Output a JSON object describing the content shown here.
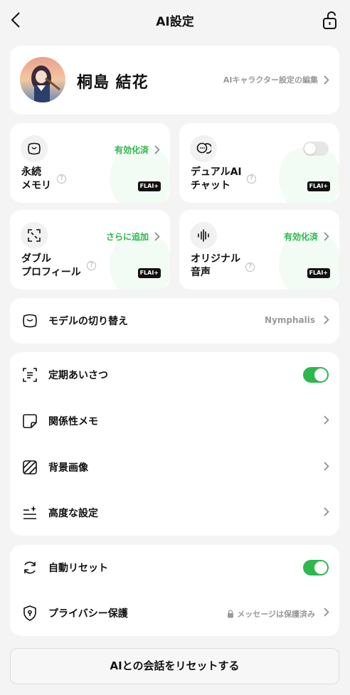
{
  "header": {
    "title": "AI設定"
  },
  "profile": {
    "name": "桐島 結花",
    "edit_label": "AIキャラクター設定の編集"
  },
  "tiles": {
    "memory": {
      "line1": "永続",
      "line2": "メモリ",
      "status": "有効化済",
      "badge": "FLAI+"
    },
    "dual_chat": {
      "line1": "デュアルAI",
      "line2": "チャット",
      "toggle": false,
      "badge": "FLAI+"
    },
    "double_profile": {
      "line1": "ダブル",
      "line2": "プロフィール",
      "status": "さらに追加",
      "badge": "FLAI+"
    },
    "original_voice": {
      "line1": "オリジナル",
      "line2": "音声",
      "status": "有効化済",
      "badge": "FLAI+"
    }
  },
  "model": {
    "label": "モデルの切り替え",
    "value": "Nymphalis"
  },
  "settings": {
    "greeting": {
      "label": "定期あいさつ",
      "toggle": true
    },
    "memo": {
      "label": "関係性メモ"
    },
    "background": {
      "label": "背景画像"
    },
    "advanced": {
      "label": "高度な設定"
    }
  },
  "misc": {
    "auto_reset": {
      "label": "自動リセット",
      "toggle": true
    },
    "privacy": {
      "label": "プライバシー保護",
      "value": "メッセージは保護済み"
    }
  },
  "reset_button": "AIとの会話をリセットする",
  "colors": {
    "accent_green": "#2db84d",
    "muted": "#999999"
  }
}
